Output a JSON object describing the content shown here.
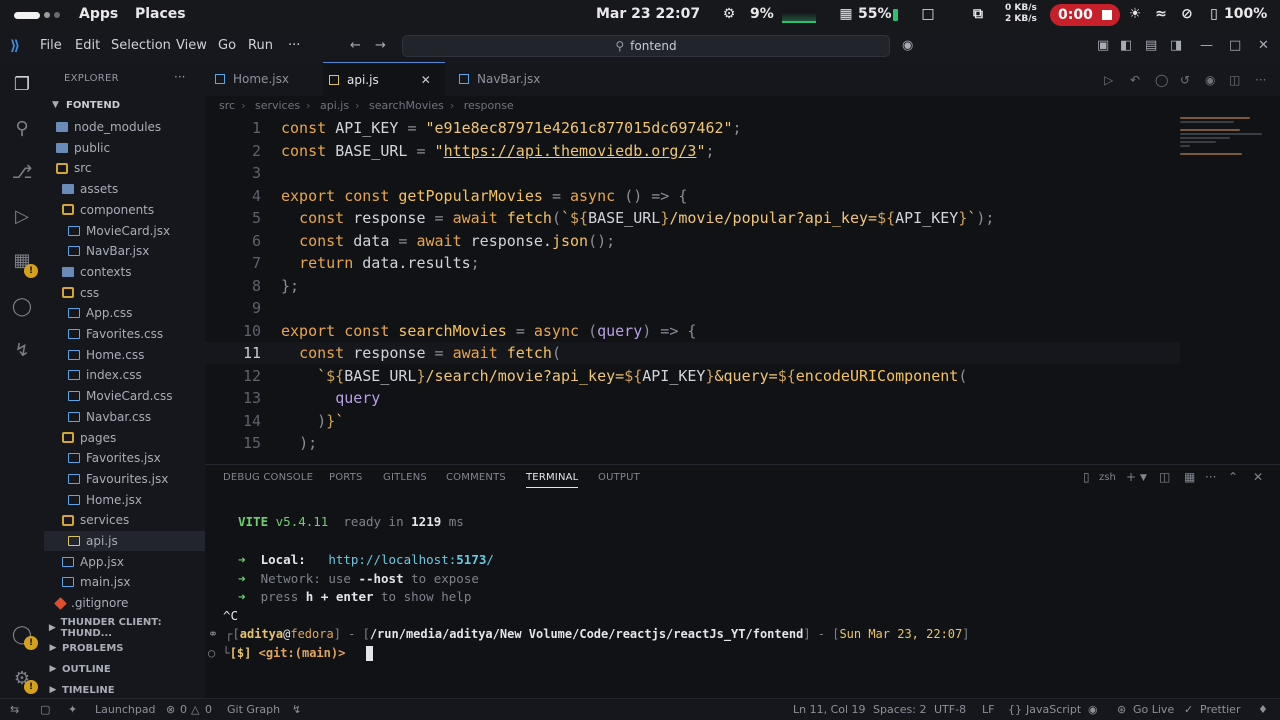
{
  "system_bar": {
    "apps": "Apps",
    "places": "Places",
    "datetime": "Mar 23  22:07",
    "cpu": "9%",
    "battery": "55%",
    "net_up": "0 KB/s",
    "net_down": "2 KB/s",
    "recording_time": "0:00",
    "volume": "100%"
  },
  "title_bar": {
    "menus": [
      "File",
      "Edit",
      "Selection",
      "View",
      "Go",
      "Run",
      "···"
    ],
    "search": "fontend"
  },
  "explorer": {
    "header": "EXPLORER",
    "root": "FONTEND",
    "items": [
      {
        "label": "node_modules",
        "kind": "folder",
        "depth": 1
      },
      {
        "label": "public",
        "kind": "folder",
        "depth": 1
      },
      {
        "label": "src",
        "kind": "folder-open",
        "depth": 1
      },
      {
        "label": "assets",
        "kind": "folder",
        "depth": 2
      },
      {
        "label": "components",
        "kind": "folder-open",
        "depth": 2
      },
      {
        "label": "MovieCard.jsx",
        "kind": "jsx",
        "depth": 3
      },
      {
        "label": "NavBar.jsx",
        "kind": "jsx",
        "depth": 3
      },
      {
        "label": "contexts",
        "kind": "folder",
        "depth": 2
      },
      {
        "label": "css",
        "kind": "folder-open",
        "depth": 2
      },
      {
        "label": "App.css",
        "kind": "css",
        "depth": 3
      },
      {
        "label": "Favorites.css",
        "kind": "css",
        "depth": 3
      },
      {
        "label": "Home.css",
        "kind": "css",
        "depth": 3
      },
      {
        "label": "index.css",
        "kind": "css",
        "depth": 3
      },
      {
        "label": "MovieCard.css",
        "kind": "css",
        "depth": 3
      },
      {
        "label": "Navbar.css",
        "kind": "css",
        "depth": 3
      },
      {
        "label": "pages",
        "kind": "folder-open",
        "depth": 2
      },
      {
        "label": "Favorites.jsx",
        "kind": "jsx",
        "depth": 3
      },
      {
        "label": "Favourites.jsx",
        "kind": "jsx",
        "depth": 3
      },
      {
        "label": "Home.jsx",
        "kind": "jsx",
        "depth": 3
      },
      {
        "label": "services",
        "kind": "folder-open",
        "depth": 2
      },
      {
        "label": "api.js",
        "kind": "js",
        "depth": 3,
        "selected": true
      },
      {
        "label": "App.jsx",
        "kind": "jsx",
        "depth": 2
      },
      {
        "label": "main.jsx",
        "kind": "jsx",
        "depth": 2
      },
      {
        "label": ".gitignore",
        "kind": "git",
        "depth": 1
      }
    ],
    "sections": [
      "THUNDER CLIENT: THUND...",
      "PROBLEMS",
      "OUTLINE",
      "TIMELINE"
    ]
  },
  "editor": {
    "tabs": [
      {
        "label": "Home.jsx",
        "active": false
      },
      {
        "label": "api.js",
        "active": true
      },
      {
        "label": "NavBar.jsx",
        "active": false
      }
    ],
    "breadcrumb": [
      "src",
      "services",
      "api.js",
      "searchMovies",
      "response"
    ],
    "current_line": 11,
    "lines": [
      {
        "n": "1",
        "tokens": [
          [
            "kw",
            "const "
          ],
          [
            "vr",
            "API_KEY "
          ],
          [
            "pu",
            "= "
          ],
          [
            "st",
            "\"e91e8ec87971e4261c877015dc697462\""
          ],
          [
            "pu",
            ";"
          ]
        ]
      },
      {
        "n": "2",
        "tokens": [
          [
            "kw",
            "const "
          ],
          [
            "vr",
            "BASE_URL "
          ],
          [
            "pu",
            "= "
          ],
          [
            "st",
            "\""
          ],
          [
            "st ul",
            "https://api.themoviedb.org/3"
          ],
          [
            "st",
            "\""
          ],
          [
            "pu",
            ";"
          ]
        ]
      },
      {
        "n": "3",
        "tokens": []
      },
      {
        "n": "4",
        "tokens": [
          [
            "kw",
            "export const "
          ],
          [
            "fn",
            "getPopularMovies "
          ],
          [
            "pu",
            "= "
          ],
          [
            "kw",
            "async "
          ],
          [
            "pu",
            "() => {"
          ]
        ]
      },
      {
        "n": "5",
        "tokens": [
          [
            "vr",
            "  "
          ],
          [
            "kw",
            "const "
          ],
          [
            "vr",
            "response "
          ],
          [
            "pu",
            "= "
          ],
          [
            "kw",
            "await "
          ],
          [
            "fn",
            "fetch"
          ],
          [
            "pu",
            "("
          ],
          [
            "st",
            "`"
          ],
          [
            "tp",
            "${"
          ],
          [
            "vr",
            "BASE_URL"
          ],
          [
            "tp",
            "}"
          ],
          [
            "st",
            "/movie/popular?api_key="
          ],
          [
            "tp",
            "${"
          ],
          [
            "vr",
            "API_KEY"
          ],
          [
            "tp",
            "}"
          ],
          [
            "st",
            "`"
          ],
          [
            "pu",
            ");"
          ]
        ]
      },
      {
        "n": "6",
        "tokens": [
          [
            "vr",
            "  "
          ],
          [
            "kw",
            "const "
          ],
          [
            "vr",
            "data "
          ],
          [
            "pu",
            "= "
          ],
          [
            "kw",
            "await "
          ],
          [
            "vr",
            "response."
          ],
          [
            "fn",
            "json"
          ],
          [
            "pu",
            "();"
          ]
        ]
      },
      {
        "n": "7",
        "tokens": [
          [
            "vr",
            "  "
          ],
          [
            "kw",
            "return "
          ],
          [
            "vr",
            "data.results"
          ],
          [
            "pu",
            ";"
          ]
        ]
      },
      {
        "n": "8",
        "tokens": [
          [
            "pu",
            "};"
          ]
        ]
      },
      {
        "n": "9",
        "tokens": []
      },
      {
        "n": "10",
        "tokens": [
          [
            "kw",
            "export const "
          ],
          [
            "fn",
            "searchMovies "
          ],
          [
            "pu",
            "= "
          ],
          [
            "kw",
            "async "
          ],
          [
            "pu",
            "("
          ],
          [
            "pr",
            "query"
          ],
          [
            "pu",
            ") => {"
          ]
        ]
      },
      {
        "n": "11",
        "tokens": [
          [
            "vr",
            "  "
          ],
          [
            "kw",
            "const "
          ],
          [
            "vr",
            "response "
          ],
          [
            "pu",
            "= "
          ],
          [
            "kw",
            "await "
          ],
          [
            "fn",
            "fetch"
          ],
          [
            "pu",
            "("
          ]
        ]
      },
      {
        "n": "12",
        "tokens": [
          [
            "vr",
            "    "
          ],
          [
            "st",
            "`"
          ],
          [
            "tp",
            "${"
          ],
          [
            "vr",
            "BASE_URL"
          ],
          [
            "tp",
            "}"
          ],
          [
            "st",
            "/search/movie?api_key="
          ],
          [
            "tp",
            "${"
          ],
          [
            "vr",
            "API_KEY"
          ],
          [
            "tp",
            "}"
          ],
          [
            "st",
            "&query="
          ],
          [
            "tp",
            "${"
          ],
          [
            "fn",
            "encodeURIComponent"
          ],
          [
            "pu",
            "("
          ]
        ]
      },
      {
        "n": "13",
        "tokens": [
          [
            "vr",
            "      "
          ],
          [
            "pr",
            "query"
          ]
        ]
      },
      {
        "n": "14",
        "tokens": [
          [
            "vr",
            "    "
          ],
          [
            "pu",
            ")"
          ],
          [
            "tp",
            "}"
          ],
          [
            "st",
            "`"
          ]
        ]
      },
      {
        "n": "15",
        "tokens": [
          [
            "vr",
            "  "
          ],
          [
            "pu",
            ");"
          ]
        ]
      }
    ]
  },
  "panel": {
    "tabs": [
      "DEBUG CONSOLE",
      "PORTS",
      "GITLENS",
      "COMMENTS",
      "TERMINAL",
      "OUTPUT"
    ],
    "active_tab": "TERMINAL",
    "shell": "zsh",
    "terminal": {
      "vite_name": "VITE",
      "vite_version": "v5.4.11",
      "ready_text": "ready in",
      "ready_ms": "1219",
      "ms": "ms",
      "arrow": "➜",
      "local_label": "Local:",
      "local_url_prefix": "http://localhost:",
      "local_port": "5173",
      "local_slash": "/",
      "network_label": "Network:",
      "network_use": "use",
      "network_flag": "--host",
      "network_expose": "to expose",
      "help_press": "press",
      "help_key": "h + enter",
      "help_rest": "to show help",
      "ctrl_c": "^C",
      "prompt_user": "aditya",
      "prompt_at": "@",
      "prompt_host": "fedora",
      "prompt_sep": "] - [",
      "prompt_path": "/run/media/aditya/New Volume/Code/reactjs/reactJs_YT/fontend",
      "prompt_sep2": "] - [",
      "prompt_date": "Sun Mar 23, 22:07",
      "prompt_end": "]",
      "prompt2_dollar": "[$]",
      "prompt2_git": "<git:(main)>"
    }
  },
  "status_bar": {
    "launchpad": "Launchpad",
    "errors": "0",
    "warnings": "0",
    "git_graph": "Git Graph",
    "position": "Ln 11, Col 19",
    "spaces": "Spaces: 2",
    "encoding": "UTF-8",
    "eol": "LF",
    "language": "JavaScript",
    "go_live": "Go Live",
    "prettier": "Prettier"
  },
  "colors": {
    "accent": "#4e8ad8",
    "record": "#c8202b",
    "warning": "#d6a11a"
  }
}
